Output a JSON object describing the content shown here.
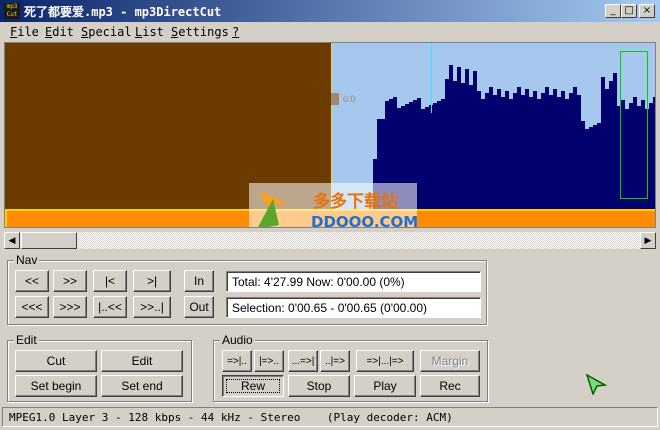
{
  "window": {
    "title": "死了都要爱.mp3 - mp3DirectCut",
    "icon_text": "mp3 Cut"
  },
  "menu": {
    "items": [
      {
        "label": "File",
        "u": "F",
        "rest": "ile"
      },
      {
        "label": "Edit",
        "u": "E",
        "rest": "dit"
      },
      {
        "label": "Special",
        "u": "S",
        "rest": "pecial"
      },
      {
        "label": "List",
        "u": "L",
        "rest": "ist"
      },
      {
        "label": "Settings",
        "u": "S",
        "rest": "ettings"
      },
      {
        "label": "?",
        "u": "?",
        "rest": ""
      }
    ]
  },
  "wave": {
    "level_label": "0.0",
    "colors": {
      "selection": "#6b3b00",
      "waveform": "#00006e",
      "background": "#a6c8ee",
      "timeline": "#ff8c00"
    }
  },
  "nav": {
    "label": "Nav",
    "row1": [
      "<<",
      ">>",
      "|<",
      ">|"
    ],
    "row2": [
      "<<<",
      ">>>",
      "|..<<",
      ">>..|"
    ],
    "in_label": "In",
    "out_label": "Out",
    "total_text": "Total: 4'27.99   Now: 0'00.00   (0%)",
    "selection_text": "Selection: 0'00.65 - 0'00.65 (0'00.00)"
  },
  "edit": {
    "label": "Edit",
    "cut_label": "Cut",
    "edit_label": "Edit",
    "set_begin_label": "Set begin",
    "set_end_label": "Set end"
  },
  "audio": {
    "label": "Audio",
    "row1": [
      "=>|..",
      "|=>..",
      "...=>|",
      "..|=>",
      "=>|...|=>"
    ],
    "margin_label": "Margin",
    "rew_label": "Rew",
    "stop_label": "Stop",
    "play_label": "Play",
    "rec_label": "Rec"
  },
  "watermark": {
    "line1": "多多下载站",
    "line2": "DDOOO.COM"
  },
  "status": {
    "text": "MPEG1.0 Layer 3 - 128 kbps - 44 kHz - Stereo    (Play decoder: ACM)"
  }
}
